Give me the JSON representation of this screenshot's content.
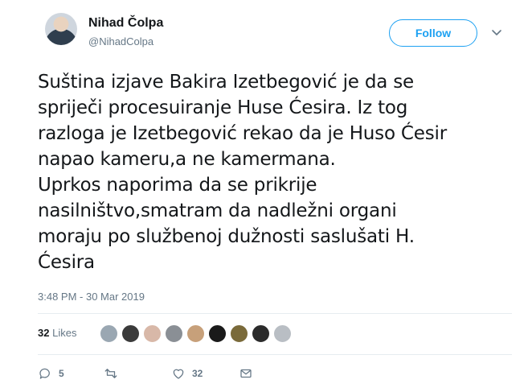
{
  "author": {
    "display_name": "Nihad Čolpa",
    "handle": "@NihadColpa"
  },
  "follow_button": {
    "label": "Follow"
  },
  "tweet": {
    "text": "Suština izjave Bakira Izetbegović je da se\nspriječi procesuiranje Huse Ćesira. Iz tog\nrazloga je Izetbegović rekao da je Huso Ćesir\nnapao kameru,a ne kamermana.\nUprkos naporima da se prikrije\nnasilništvo,smatram da nadležni organi\nmoraju po službenoj dužnosti saslušati H.\nĆesira",
    "timestamp": "3:48 PM - 30 Mar 2019"
  },
  "stats": {
    "likes_count": "32",
    "likes_label": "Likes"
  },
  "liker_avatars": [
    {
      "color": "#9aa7b2"
    },
    {
      "color": "#3a3a3a"
    },
    {
      "color": "#d8b8a8"
    },
    {
      "color": "#8a8f95"
    },
    {
      "color": "#c7a07a"
    },
    {
      "color": "#1a1a1a"
    },
    {
      "color": "#7a6a3a"
    },
    {
      "color": "#2b2b2b"
    },
    {
      "color": "#b9bec4"
    }
  ],
  "actions": {
    "reply_count": "5",
    "retweet_count": "",
    "like_count": "32"
  },
  "colors": {
    "accent": "#1da1f2",
    "secondary_text": "#657786",
    "divider": "#e6ecf0"
  }
}
